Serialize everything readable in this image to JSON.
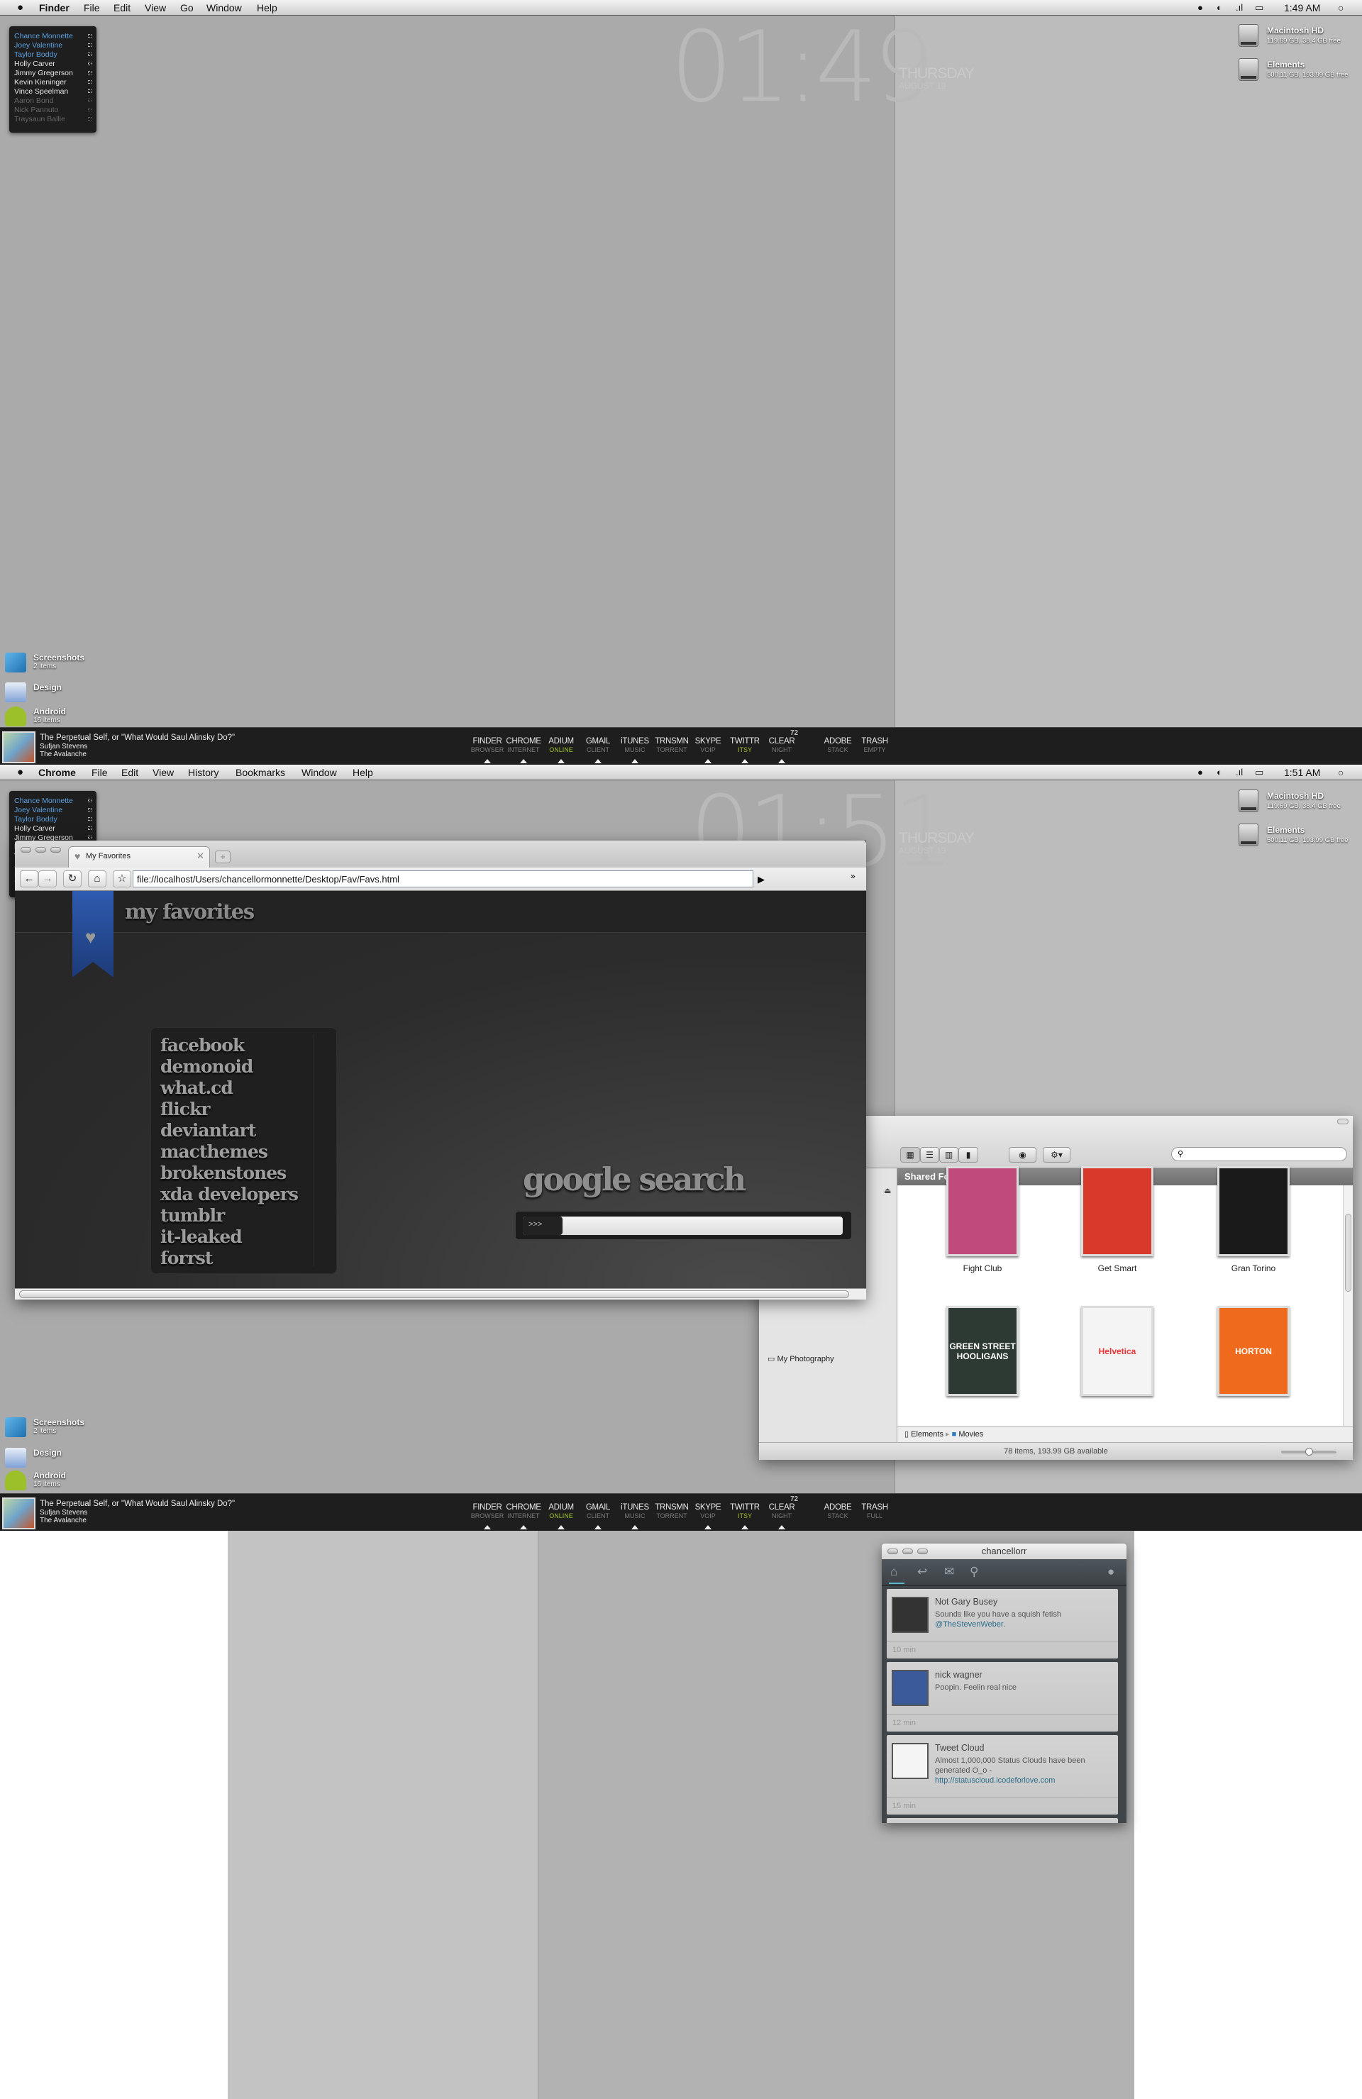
{
  "colors": {
    "accent_blue": "#5aa0e0",
    "online_green": "#9bc02a",
    "link": "#2c6d8a",
    "ribbon": "#2f5bb0"
  },
  "screen1": {
    "menubar": {
      "apple_icon": "apple-icon",
      "app": "Finder",
      "items": [
        "File",
        "Edit",
        "View",
        "Go",
        "Window",
        "Help"
      ],
      "status_icons": [
        "adium-icon",
        "growl-icon",
        "wifi-signal-icon",
        "battery-icon"
      ],
      "time": "1:49 AM",
      "spotlight_icon": "spotlight-icon"
    },
    "clock": {
      "time": "01:49",
      "day": "THURSDAY",
      "date": "AUGUST 19"
    },
    "dock_trash_sub": "EMPTY"
  },
  "screen2": {
    "menubar": {
      "apple_icon": "apple-icon",
      "app": "Chrome",
      "items": [
        "File",
        "Edit",
        "View",
        "History",
        "Bookmarks",
        "Window",
        "Help"
      ],
      "time": "1:51 AM"
    },
    "clock": {
      "time": "01:51",
      "day": "THURSDAY",
      "date": "AUGUST 19"
    },
    "dock_trash_sub": "FULL"
  },
  "buddies": [
    {
      "name": "Chance Monnette",
      "status": "active"
    },
    {
      "name": "Joey Valentine",
      "status": "active"
    },
    {
      "name": "Taylor Boddy",
      "status": "active"
    },
    {
      "name": "Holly Carver",
      "status": "online"
    },
    {
      "name": "Jimmy Gregerson",
      "status": "online"
    },
    {
      "name": "Kevin Kieninger",
      "status": "online"
    },
    {
      "name": "Vince Speelman",
      "status": "online"
    },
    {
      "name": "Aaron Bond",
      "status": "away"
    },
    {
      "name": "Nick Pannuto",
      "status": "away"
    },
    {
      "name": "Traysaun Ballie",
      "status": "away"
    }
  ],
  "drives": [
    {
      "name": "Macintosh HD",
      "size": "119.69 GB, 38.4 GB free"
    },
    {
      "name": "Elements",
      "size": "500.11 GB, 193.99 GB free"
    }
  ],
  "desktop_icons": [
    {
      "name": "Screenshots",
      "count": "2 items",
      "icon": "monitor-icon"
    },
    {
      "name": "Design",
      "count": "",
      "icon": "design-folder-icon"
    },
    {
      "name": "Android",
      "count": "16 items",
      "icon": "android-icon"
    }
  ],
  "now_playing": {
    "track": "The Perpetual Self, or \"What Would Saul Alinsky Do?\"",
    "artist": "Sufjan Stevens",
    "album": "The Avalanche"
  },
  "dock": [
    {
      "label": "FINDER",
      "sub": "BROWSER",
      "running": true
    },
    {
      "label": "CHROME",
      "sub": "INTERNET",
      "running": true
    },
    {
      "label": "ADIUM",
      "sub": "ONLINE",
      "running": true,
      "highlight": true
    },
    {
      "label": "GMAIL",
      "sub": "CLIENT",
      "running": true
    },
    {
      "label": "iTUNES",
      "sub": "MUSIC",
      "running": true
    },
    {
      "label": "TRNSMN",
      "sub": "TORRENT",
      "running": false
    },
    {
      "label": "SKYPE",
      "sub": "VOIP",
      "running": true
    },
    {
      "label": "TWITTR",
      "sub": "ITSY",
      "running": true,
      "highlight": true
    },
    {
      "label": "CLEAR",
      "sub": "NIGHT",
      "running": true,
      "badge": "72"
    },
    {
      "label": "ADOBE",
      "sub": "STACK",
      "running": false
    },
    {
      "label": "TRASH",
      "sub": "",
      "running": false
    }
  ],
  "chrome": {
    "tab_title": "My Favorites",
    "url": "file://localhost/Users/chancellormonnette/Desktop/Fav/Favs.html",
    "page_title": "my favorites",
    "favorites": [
      "facebook",
      "demonoid",
      "what.cd",
      "flickr",
      "deviantart",
      "macthemes",
      "brokenstones",
      "xda developers",
      "tumblr",
      "it-leaked",
      "forrst"
    ],
    "search_heading": "google search",
    "search_button": ">>>",
    "search_value": ""
  },
  "finder": {
    "header": "Shared Folder",
    "sidebar_item": "My Photography",
    "search_value": "",
    "movies": [
      {
        "title": "Fight Club",
        "cover_color": "#c04a7a"
      },
      {
        "title": "Get Smart",
        "cover_color": "#d8392a"
      },
      {
        "title": "Gran Torino",
        "cover_color": "#1a1a1a"
      },
      {
        "title": "",
        "cover_text": "GREEN STREET HOOLIGANS",
        "cover_color": "#2d3a33"
      },
      {
        "title": "",
        "cover_text": "Helvetica",
        "cover_color": "#f4f4f4"
      },
      {
        "title": "",
        "cover_text": "HORTON",
        "cover_color": "#ef6a1c"
      }
    ],
    "path": [
      "Elements",
      "Movies"
    ],
    "status": "78 items, 193.99 GB available",
    "zoom_level": 0.5
  },
  "twitter": {
    "title": "chancellorr",
    "toolbar_icons": [
      "home-icon",
      "reply-icon",
      "mail-icon",
      "search-icon",
      "compose-icon"
    ],
    "tweets": [
      {
        "name": "Not Gary Busey",
        "text": "Sounds like you have a squish fetish ",
        "link": "@TheStevenWeber",
        "after": ".",
        "time": "10 min",
        "avatar_color": "#333"
      },
      {
        "name": "nick wagner",
        "text": "Poopin. Feelin real nice",
        "link": "",
        "after": "",
        "time": "12 min",
        "avatar_color": "#3a5a9a"
      },
      {
        "name": "Tweet Cloud",
        "text": "Almost 1,000,000 Status Clouds have been generated O_o - ",
        "link": "http://statuscloud.icodeforlove.com",
        "after": "",
        "time": "15 min",
        "avatar_color": "#f4f4f4"
      }
    ]
  }
}
